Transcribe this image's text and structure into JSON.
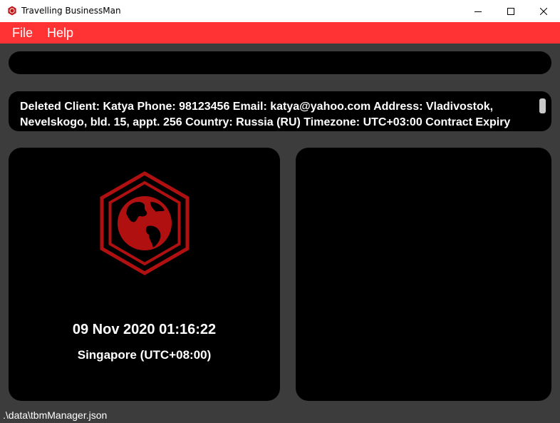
{
  "window": {
    "title": "Travelling BusinessMan"
  },
  "menu": {
    "file": "File",
    "help": "Help"
  },
  "command": {
    "value": ""
  },
  "result": {
    "text": "Deleted Client: Katya Phone: 98123456 Email: katya@yahoo.com Address: Vladivostok, Nevelskogo, bld. 15, appt. 256 Country: Russia (RU) Timezone: UTC+03:00 Contract Expiry"
  },
  "clock": {
    "datetime": "09 Nov 2020 01:16:22",
    "timezone": "Singapore (UTC+08:00)"
  },
  "status": {
    "path": ".\\data\\tbmManager.json"
  },
  "colors": {
    "menubar": "#ff3333",
    "logo": "#b01010",
    "background": "#3c3c3c",
    "panel": "#000000"
  },
  "icons": {
    "app": "globe-hexagon-icon",
    "logo": "globe-hexagon-icon",
    "minimize": "minimize-icon",
    "maximize": "maximize-icon",
    "close": "close-icon"
  }
}
